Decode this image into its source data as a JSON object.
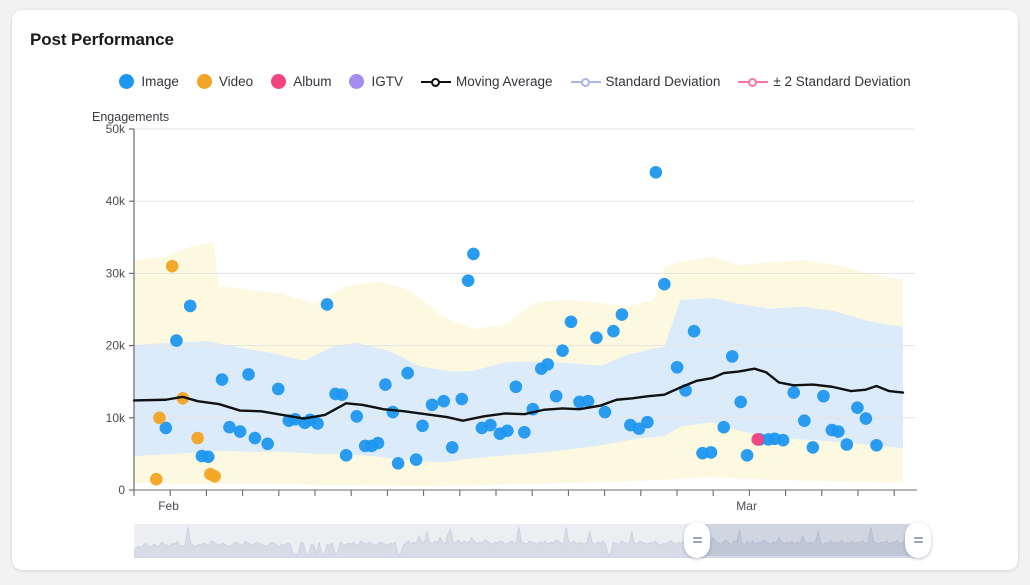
{
  "card": {
    "title": "Post Performance"
  },
  "legend": {
    "items": [
      {
        "label": "Image",
        "type": "dot",
        "color": "#1f97ef"
      },
      {
        "label": "Video",
        "type": "dot",
        "color": "#f2a424"
      },
      {
        "label": "Album",
        "type": "dot",
        "color": "#f5437e"
      },
      {
        "label": "IGTV",
        "type": "dot",
        "color": "#a78cf0"
      },
      {
        "label": "Moving Average",
        "type": "line",
        "color": "#111111"
      },
      {
        "label": "Standard Deviation",
        "type": "line",
        "color": "#a9b6ee"
      },
      {
        "label": "± 2 Standard Deviation",
        "type": "line",
        "color": "#f773a8"
      }
    ]
  },
  "chart_data": {
    "type": "scatter",
    "title": "Post Performance",
    "xlabel": "",
    "ylabel": "Engagements",
    "ylim": [
      0,
      50000
    ],
    "yticks": [
      0,
      10000,
      20000,
      30000,
      40000,
      50000
    ],
    "ytick_labels": [
      "0",
      "10k",
      "20k",
      "30k",
      "40k",
      "50k"
    ],
    "xtick_labels": [
      "Feb",
      "Mar"
    ],
    "xtick_positions": [
      0.02,
      0.565
    ],
    "grid": true,
    "legend_position": "top-center",
    "colors": {
      "image": "#1f97ef",
      "video": "#f2a424",
      "album": "#f5437e",
      "igtv": "#a78cf0",
      "moving_average": "#111111",
      "std_band": "#dcebfa",
      "std2_band": "#fdf8e0"
    },
    "series": [
      {
        "name": "Image",
        "color": "#1f97ef",
        "points": [
          [
            0.03,
            8600
          ],
          [
            0.04,
            20700
          ],
          [
            0.053,
            25500
          ],
          [
            0.064,
            4700
          ],
          [
            0.07,
            4600
          ],
          [
            0.083,
            15300
          ],
          [
            0.09,
            8700
          ],
          [
            0.1,
            8100
          ],
          [
            0.108,
            16000
          ],
          [
            0.114,
            7200
          ],
          [
            0.126,
            6400
          ],
          [
            0.136,
            14000
          ],
          [
            0.146,
            9600
          ],
          [
            0.152,
            9800
          ],
          [
            0.161,
            9300
          ],
          [
            0.166,
            9700
          ],
          [
            0.173,
            9200
          ],
          [
            0.182,
            25700
          ],
          [
            0.19,
            13300
          ],
          [
            0.196,
            13200
          ],
          [
            0.2,
            4800
          ],
          [
            0.21,
            10200
          ],
          [
            0.218,
            6100
          ],
          [
            0.224,
            6100
          ],
          [
            0.23,
            6500
          ],
          [
            0.237,
            14600
          ],
          [
            0.244,
            10800
          ],
          [
            0.249,
            3700
          ],
          [
            0.258,
            16200
          ],
          [
            0.266,
            4200
          ],
          [
            0.272,
            8900
          ],
          [
            0.281,
            11800
          ],
          [
            0.292,
            12300
          ],
          [
            0.3,
            5900
          ],
          [
            0.309,
            12600
          ],
          [
            0.315,
            29000
          ],
          [
            0.32,
            32700
          ],
          [
            0.328,
            8600
          ],
          [
            0.336,
            9000
          ],
          [
            0.345,
            7800
          ],
          [
            0.352,
            8200
          ],
          [
            0.36,
            14300
          ],
          [
            0.368,
            8000
          ],
          [
            0.376,
            11200
          ],
          [
            0.384,
            16800
          ],
          [
            0.39,
            17400
          ],
          [
            0.398,
            13000
          ],
          [
            0.404,
            19300
          ],
          [
            0.412,
            23300
          ],
          [
            0.42,
            12200
          ],
          [
            0.428,
            12300
          ],
          [
            0.436,
            21100
          ],
          [
            0.444,
            10800
          ],
          [
            0.452,
            22000
          ],
          [
            0.46,
            24300
          ],
          [
            0.468,
            9000
          ],
          [
            0.476,
            8500
          ],
          [
            0.484,
            9400
          ],
          [
            0.492,
            44000
          ],
          [
            0.5,
            28500
          ],
          [
            0.512,
            17000
          ],
          [
            0.52,
            13800
          ],
          [
            0.528,
            22000
          ],
          [
            0.536,
            5100
          ],
          [
            0.544,
            5200
          ],
          [
            0.556,
            8700
          ],
          [
            0.564,
            18500
          ],
          [
            0.572,
            12200
          ],
          [
            0.578,
            4800
          ],
          [
            0.59,
            7000
          ],
          [
            0.598,
            7000
          ],
          [
            0.604,
            7100
          ],
          [
            0.612,
            6900
          ],
          [
            0.622,
            13500
          ],
          [
            0.632,
            9600
          ],
          [
            0.64,
            5900
          ],
          [
            0.65,
            13000
          ],
          [
            0.658,
            8300
          ],
          [
            0.664,
            8100
          ],
          [
            0.672,
            6300
          ],
          [
            0.682,
            11400
          ],
          [
            0.69,
            9900
          ],
          [
            0.7,
            6200
          ]
        ]
      },
      {
        "name": "Video",
        "color": "#f2a424",
        "points": [
          [
            0.021,
            1500
          ],
          [
            0.024,
            10000
          ],
          [
            0.036,
            31000
          ],
          [
            0.046,
            12700
          ],
          [
            0.06,
            7200
          ],
          [
            0.072,
            2200
          ],
          [
            0.076,
            1900
          ]
        ]
      },
      {
        "name": "Album",
        "color": "#f5437e",
        "points": [
          [
            0.588,
            7000
          ]
        ]
      },
      {
        "name": "IGTV",
        "color": "#a78cf0",
        "points": []
      }
    ],
    "moving_average": [
      [
        0.0,
        12400
      ],
      [
        0.03,
        12500
      ],
      [
        0.046,
        12900
      ],
      [
        0.06,
        12300
      ],
      [
        0.08,
        11900
      ],
      [
        0.1,
        11000
      ],
      [
        0.12,
        10900
      ],
      [
        0.14,
        10400
      ],
      [
        0.16,
        9900
      ],
      [
        0.18,
        10400
      ],
      [
        0.2,
        12000
      ],
      [
        0.215,
        11800
      ],
      [
        0.235,
        11200
      ],
      [
        0.255,
        10900
      ],
      [
        0.275,
        10500
      ],
      [
        0.295,
        10100
      ],
      [
        0.31,
        9600
      ],
      [
        0.33,
        10200
      ],
      [
        0.35,
        10600
      ],
      [
        0.368,
        10500
      ],
      [
        0.386,
        11100
      ],
      [
        0.404,
        11300
      ],
      [
        0.42,
        11200
      ],
      [
        0.44,
        11700
      ],
      [
        0.455,
        12500
      ],
      [
        0.47,
        12700
      ],
      [
        0.485,
        13000
      ],
      [
        0.5,
        13200
      ],
      [
        0.515,
        14200
      ],
      [
        0.53,
        15100
      ],
      [
        0.545,
        15500
      ],
      [
        0.556,
        16200
      ],
      [
        0.57,
        16400
      ],
      [
        0.585,
        16800
      ],
      [
        0.596,
        16300
      ],
      [
        0.608,
        14900
      ],
      [
        0.622,
        14500
      ],
      [
        0.64,
        14600
      ],
      [
        0.658,
        14300
      ],
      [
        0.676,
        13700
      ],
      [
        0.69,
        13900
      ],
      [
        0.7,
        14400
      ],
      [
        0.712,
        13700
      ],
      [
        0.725,
        13500
      ]
    ],
    "std_band": {
      "upper": [
        [
          0.0,
          20100
        ],
        [
          0.05,
          20500
        ],
        [
          0.07,
          20600
        ],
        [
          0.1,
          19700
        ],
        [
          0.13,
          19000
        ],
        [
          0.16,
          17900
        ],
        [
          0.19,
          20000
        ],
        [
          0.21,
          20400
        ],
        [
          0.24,
          19300
        ],
        [
          0.27,
          17100
        ],
        [
          0.3,
          16400
        ],
        [
          0.32,
          16500
        ],
        [
          0.35,
          17700
        ],
        [
          0.38,
          17800
        ],
        [
          0.41,
          17600
        ],
        [
          0.44,
          17200
        ],
        [
          0.465,
          18700
        ],
        [
          0.49,
          19600
        ],
        [
          0.5,
          19800
        ],
        [
          0.515,
          26300
        ],
        [
          0.545,
          26600
        ],
        [
          0.57,
          25800
        ],
        [
          0.6,
          25100
        ],
        [
          0.63,
          25400
        ],
        [
          0.66,
          24800
        ],
        [
          0.69,
          23500
        ],
        [
          0.71,
          22900
        ],
        [
          0.725,
          22600
        ]
      ],
      "lower": [
        [
          0.0,
          4700
        ],
        [
          0.05,
          5100
        ],
        [
          0.08,
          5400
        ],
        [
          0.11,
          5300
        ],
        [
          0.14,
          5300
        ],
        [
          0.17,
          5000
        ],
        [
          0.2,
          5000
        ],
        [
          0.23,
          4600
        ],
        [
          0.26,
          4100
        ],
        [
          0.29,
          3800
        ],
        [
          0.32,
          4400
        ],
        [
          0.35,
          4800
        ],
        [
          0.38,
          5100
        ],
        [
          0.41,
          5600
        ],
        [
          0.44,
          6200
        ],
        [
          0.47,
          7000
        ],
        [
          0.5,
          7500
        ],
        [
          0.515,
          8800
        ],
        [
          0.545,
          9400
        ],
        [
          0.57,
          8200
        ],
        [
          0.6,
          7300
        ],
        [
          0.63,
          7000
        ],
        [
          0.66,
          6700
        ],
        [
          0.69,
          6300
        ],
        [
          0.71,
          6000
        ],
        [
          0.725,
          5800
        ]
      ]
    },
    "std2_band": {
      "upper": [
        [
          0.0,
          31800
        ],
        [
          0.03,
          32300
        ],
        [
          0.055,
          33800
        ],
        [
          0.075,
          34300
        ],
        [
          0.08,
          28300
        ],
        [
          0.11,
          27700
        ],
        [
          0.14,
          27200
        ],
        [
          0.17,
          25800
        ],
        [
          0.2,
          28200
        ],
        [
          0.23,
          28900
        ],
        [
          0.26,
          27700
        ],
        [
          0.29,
          24100
        ],
        [
          0.32,
          22300
        ],
        [
          0.35,
          22900
        ],
        [
          0.38,
          26100
        ],
        [
          0.41,
          26300
        ],
        [
          0.44,
          25900
        ],
        [
          0.465,
          25400
        ],
        [
          0.49,
          26300
        ],
        [
          0.5,
          30800
        ],
        [
          0.515,
          31600
        ],
        [
          0.545,
          32300
        ],
        [
          0.57,
          31100
        ],
        [
          0.6,
          31600
        ],
        [
          0.63,
          31800
        ],
        [
          0.66,
          31200
        ],
        [
          0.69,
          30100
        ],
        [
          0.71,
          29400
        ],
        [
          0.725,
          29200
        ]
      ],
      "lower": [
        [
          0.0,
          1000
        ],
        [
          0.03,
          900
        ],
        [
          0.06,
          800
        ],
        [
          0.09,
          900
        ],
        [
          0.12,
          900
        ],
        [
          0.15,
          800
        ],
        [
          0.18,
          700
        ],
        [
          0.21,
          700
        ],
        [
          0.24,
          600
        ],
        [
          0.27,
          500
        ],
        [
          0.3,
          600
        ],
        [
          0.33,
          700
        ],
        [
          0.36,
          800
        ],
        [
          0.39,
          900
        ],
        [
          0.42,
          1000
        ],
        [
          0.45,
          1100
        ],
        [
          0.48,
          1300
        ],
        [
          0.51,
          1500
        ],
        [
          0.54,
          1800
        ],
        [
          0.57,
          1600
        ],
        [
          0.6,
          1400
        ],
        [
          0.63,
          1300
        ],
        [
          0.66,
          1200
        ],
        [
          0.69,
          1100
        ],
        [
          0.725,
          1000
        ]
      ]
    }
  },
  "brush": {
    "selection_start_pct": 71.5,
    "selection_end_pct": 99.5,
    "left_handle_icon": "grip-handle-icon",
    "right_handle_icon": "grip-handle-icon",
    "sparkline": [
      6,
      8,
      7,
      9,
      11,
      8,
      7,
      10,
      9,
      8,
      12,
      10,
      9,
      8,
      11,
      10,
      13,
      9,
      8,
      10,
      26,
      12,
      9,
      8,
      10,
      9,
      11,
      10,
      9,
      13,
      12,
      10,
      9,
      11,
      10,
      9,
      8,
      10,
      12,
      11,
      9,
      10,
      13,
      11,
      10,
      9,
      12,
      11,
      10,
      9,
      8,
      10,
      12,
      11,
      9,
      8,
      10,
      9,
      11,
      10,
      1,
      1,
      1,
      12,
      11,
      1,
      1,
      10,
      9,
      1,
      12,
      1,
      1,
      10,
      9,
      11,
      1,
      1,
      12,
      10,
      9,
      11,
      10,
      12,
      9,
      10,
      13,
      11,
      10,
      12,
      11,
      9,
      10,
      12,
      11,
      10,
      9,
      11,
      10,
      12,
      1,
      1,
      9,
      11,
      13,
      10,
      12,
      11,
      18,
      13,
      11,
      22,
      12,
      10,
      13,
      11,
      16,
      12,
      10,
      19,
      24,
      12,
      11,
      14,
      10,
      13,
      12,
      11,
      16,
      13,
      10,
      12,
      11,
      14,
      13,
      11,
      10,
      12,
      11,
      13,
      12,
      10,
      11,
      13,
      12,
      10,
      26,
      12,
      11,
      10,
      13,
      12,
      11,
      10,
      12,
      11,
      13,
      10,
      12,
      11,
      14,
      13,
      11,
      10,
      26,
      12,
      11,
      13,
      10,
      12,
      11,
      10,
      12,
      22,
      11,
      10,
      12,
      11,
      13,
      10,
      1,
      1,
      12,
      11,
      10,
      13,
      12,
      11,
      10,
      22,
      11,
      10,
      13,
      12,
      11,
      10,
      12,
      11,
      13,
      10,
      9,
      11,
      10,
      12,
      13,
      11,
      10,
      12,
      11,
      13,
      20,
      12,
      11,
      10,
      13,
      12,
      11,
      10,
      12,
      11,
      16,
      13,
      11,
      10,
      12,
      14,
      11,
      10,
      13,
      12,
      24,
      11,
      10,
      12,
      11,
      13,
      10,
      12,
      11,
      14,
      13,
      11,
      10,
      12,
      11,
      16,
      13,
      10,
      12,
      11,
      13,
      10,
      12,
      11,
      18,
      13,
      10,
      12,
      11,
      13,
      22,
      11,
      10,
      12,
      11,
      13,
      10,
      12,
      11,
      14,
      10,
      12,
      11,
      13,
      10,
      12,
      11,
      13,
      10,
      12,
      26,
      13,
      11,
      10,
      12,
      11,
      13,
      10,
      12,
      11,
      14,
      10,
      12,
      11,
      13,
      10,
      12,
      11,
      13,
      10
    ]
  }
}
